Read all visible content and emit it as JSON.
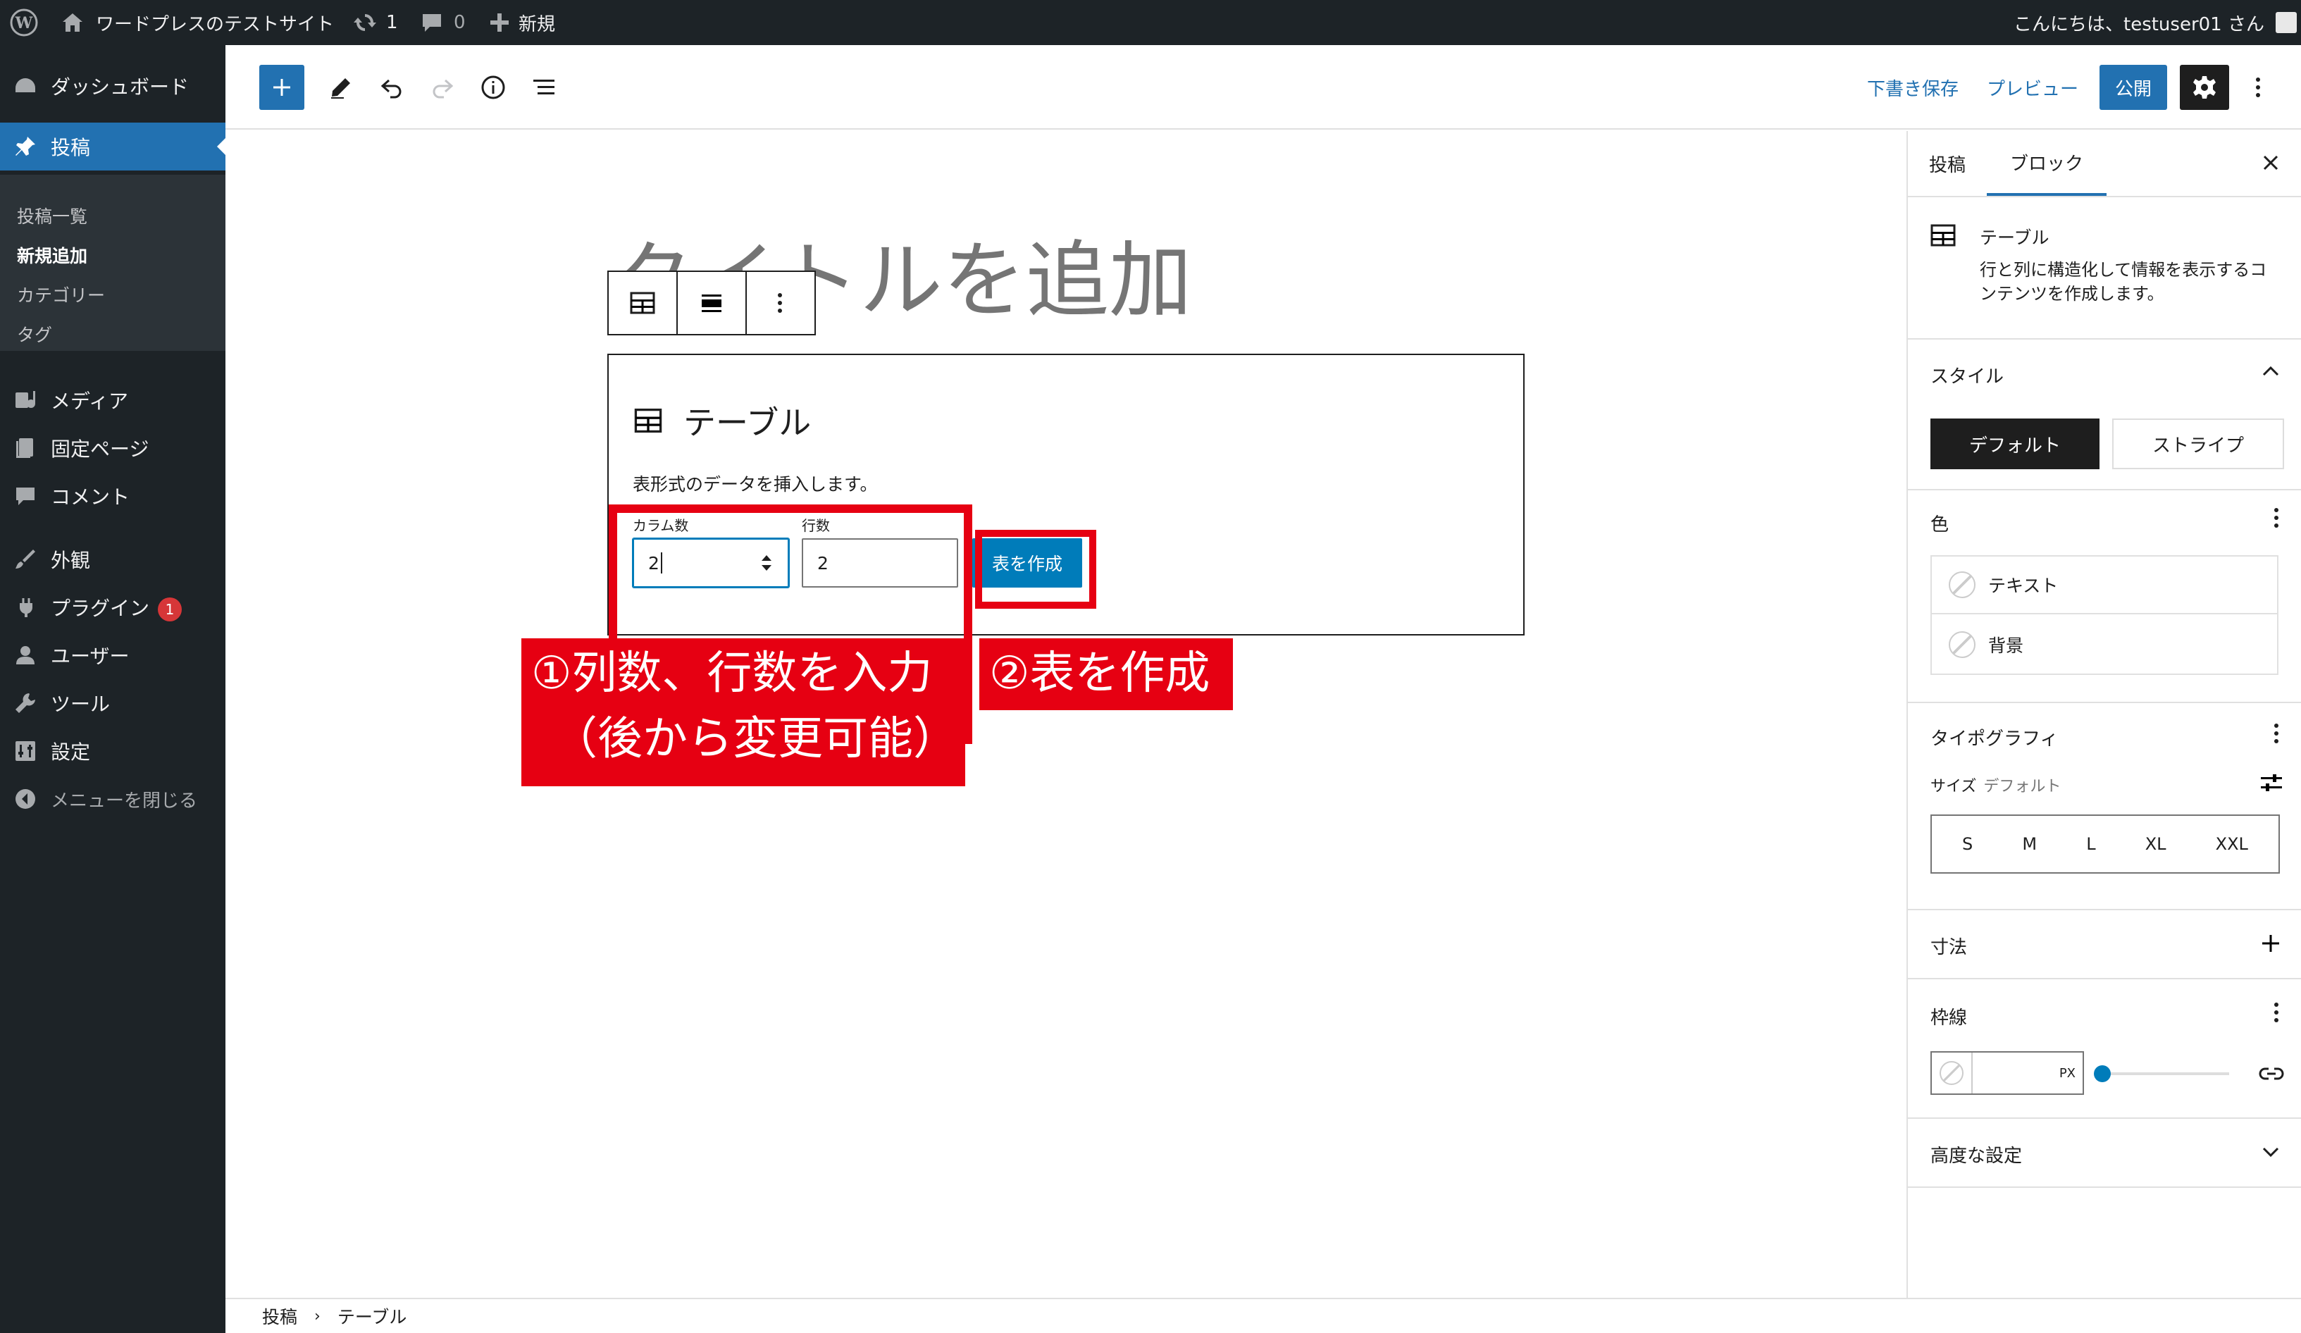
{
  "adminbar": {
    "site_name": "ワードプレスのテストサイト",
    "updates_count": "1",
    "comments_count": "0",
    "new_label": "新規",
    "greeting": "こんにちは、testuser01 さん"
  },
  "menu": {
    "dashboard": "ダッシュボード",
    "posts": "投稿",
    "sub": [
      "投稿一覧",
      "新規追加",
      "カテゴリー",
      "タグ"
    ],
    "media": "メディア",
    "pages": "固定ページ",
    "comments": "コメント",
    "appearance": "外観",
    "plugins": "プラグイン",
    "plugins_badge": "1",
    "users": "ユーザー",
    "tools": "ツール",
    "settings": "設定",
    "collapse": "メニューを閉じる"
  },
  "toolbar": {
    "save_draft": "下書き保存",
    "preview": "プレビュー",
    "publish": "公開"
  },
  "editor": {
    "title_placeholder": "タイトルを追加",
    "block_title": "テーブル",
    "block_desc": "表形式のデータを挿入します。",
    "columns_label": "カラム数",
    "rows_label": "行数",
    "columns_value": "2",
    "rows_value": "2",
    "create_button": "表を作成"
  },
  "annotations": {
    "note1_line1": "①列数、行数を入力",
    "note1_line2": "（後から変更可能）",
    "note2": "②表を作成",
    "highlight_color": "#e60012"
  },
  "sidebar": {
    "tab_post": "投稿",
    "tab_block": "ブロック",
    "block_name": "テーブル",
    "block_desc": "行と列に構造化して情報を表示するコンテンツを作成します。",
    "style_title": "スタイル",
    "style_default": "デフォルト",
    "style_stripe": "ストライプ",
    "color_title": "色",
    "color_text": "テキスト",
    "color_bg": "背景",
    "typo_title": "タイポグラフィ",
    "size_label": "サイズ",
    "size_value": "デフォルト",
    "sizes": [
      "S",
      "M",
      "L",
      "XL",
      "XXL"
    ],
    "dimensions_title": "寸法",
    "border_title": "枠線",
    "border_unit": "PX",
    "advanced_title": "高度な設定"
  },
  "breadcrumb": {
    "root": "投稿",
    "current": "テーブル"
  },
  "colors": {
    "accent": "#2271b1",
    "wp_blue": "#007cba",
    "admin_dark": "#1d2327"
  }
}
